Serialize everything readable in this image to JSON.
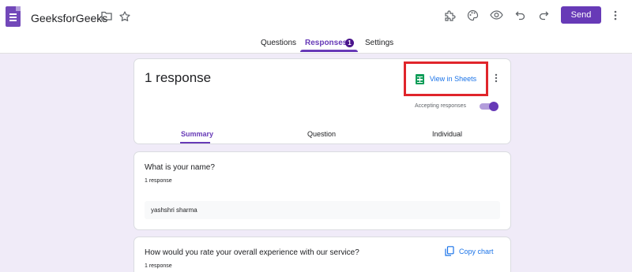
{
  "header": {
    "title": "GeeksforGeeks",
    "send_label": "Send",
    "icons": [
      "forms-logo-icon",
      "folder-icon",
      "star-icon",
      "addon-icon",
      "palette-icon",
      "preview-eye-icon",
      "undo-icon",
      "redo-icon",
      "more-vert-icon"
    ]
  },
  "tabs": [
    {
      "label": "Questions",
      "active": false
    },
    {
      "label": "Responses",
      "active": true,
      "badge": "1"
    },
    {
      "label": "Settings",
      "active": false
    }
  ],
  "summary_card": {
    "title": "1 response",
    "view_in_sheets": "View in Sheets",
    "accepting_label": "Accepting responses",
    "accepting_on": true,
    "subtabs": [
      {
        "label": "Summary",
        "active": true
      },
      {
        "label": "Question",
        "active": false
      },
      {
        "label": "Individual",
        "active": false
      }
    ]
  },
  "questions": [
    {
      "title": "What is your name?",
      "count": "1 response",
      "answers": [
        "yashshri sharma"
      ]
    },
    {
      "title": "How would you rate your overall experience with our service?",
      "count": "1 response",
      "copy_chart": "Copy chart"
    }
  ],
  "colors": {
    "accent": "#673ab7",
    "highlight": "#e0252b",
    "link": "#1a73e8",
    "background": "#f0ebf8"
  }
}
